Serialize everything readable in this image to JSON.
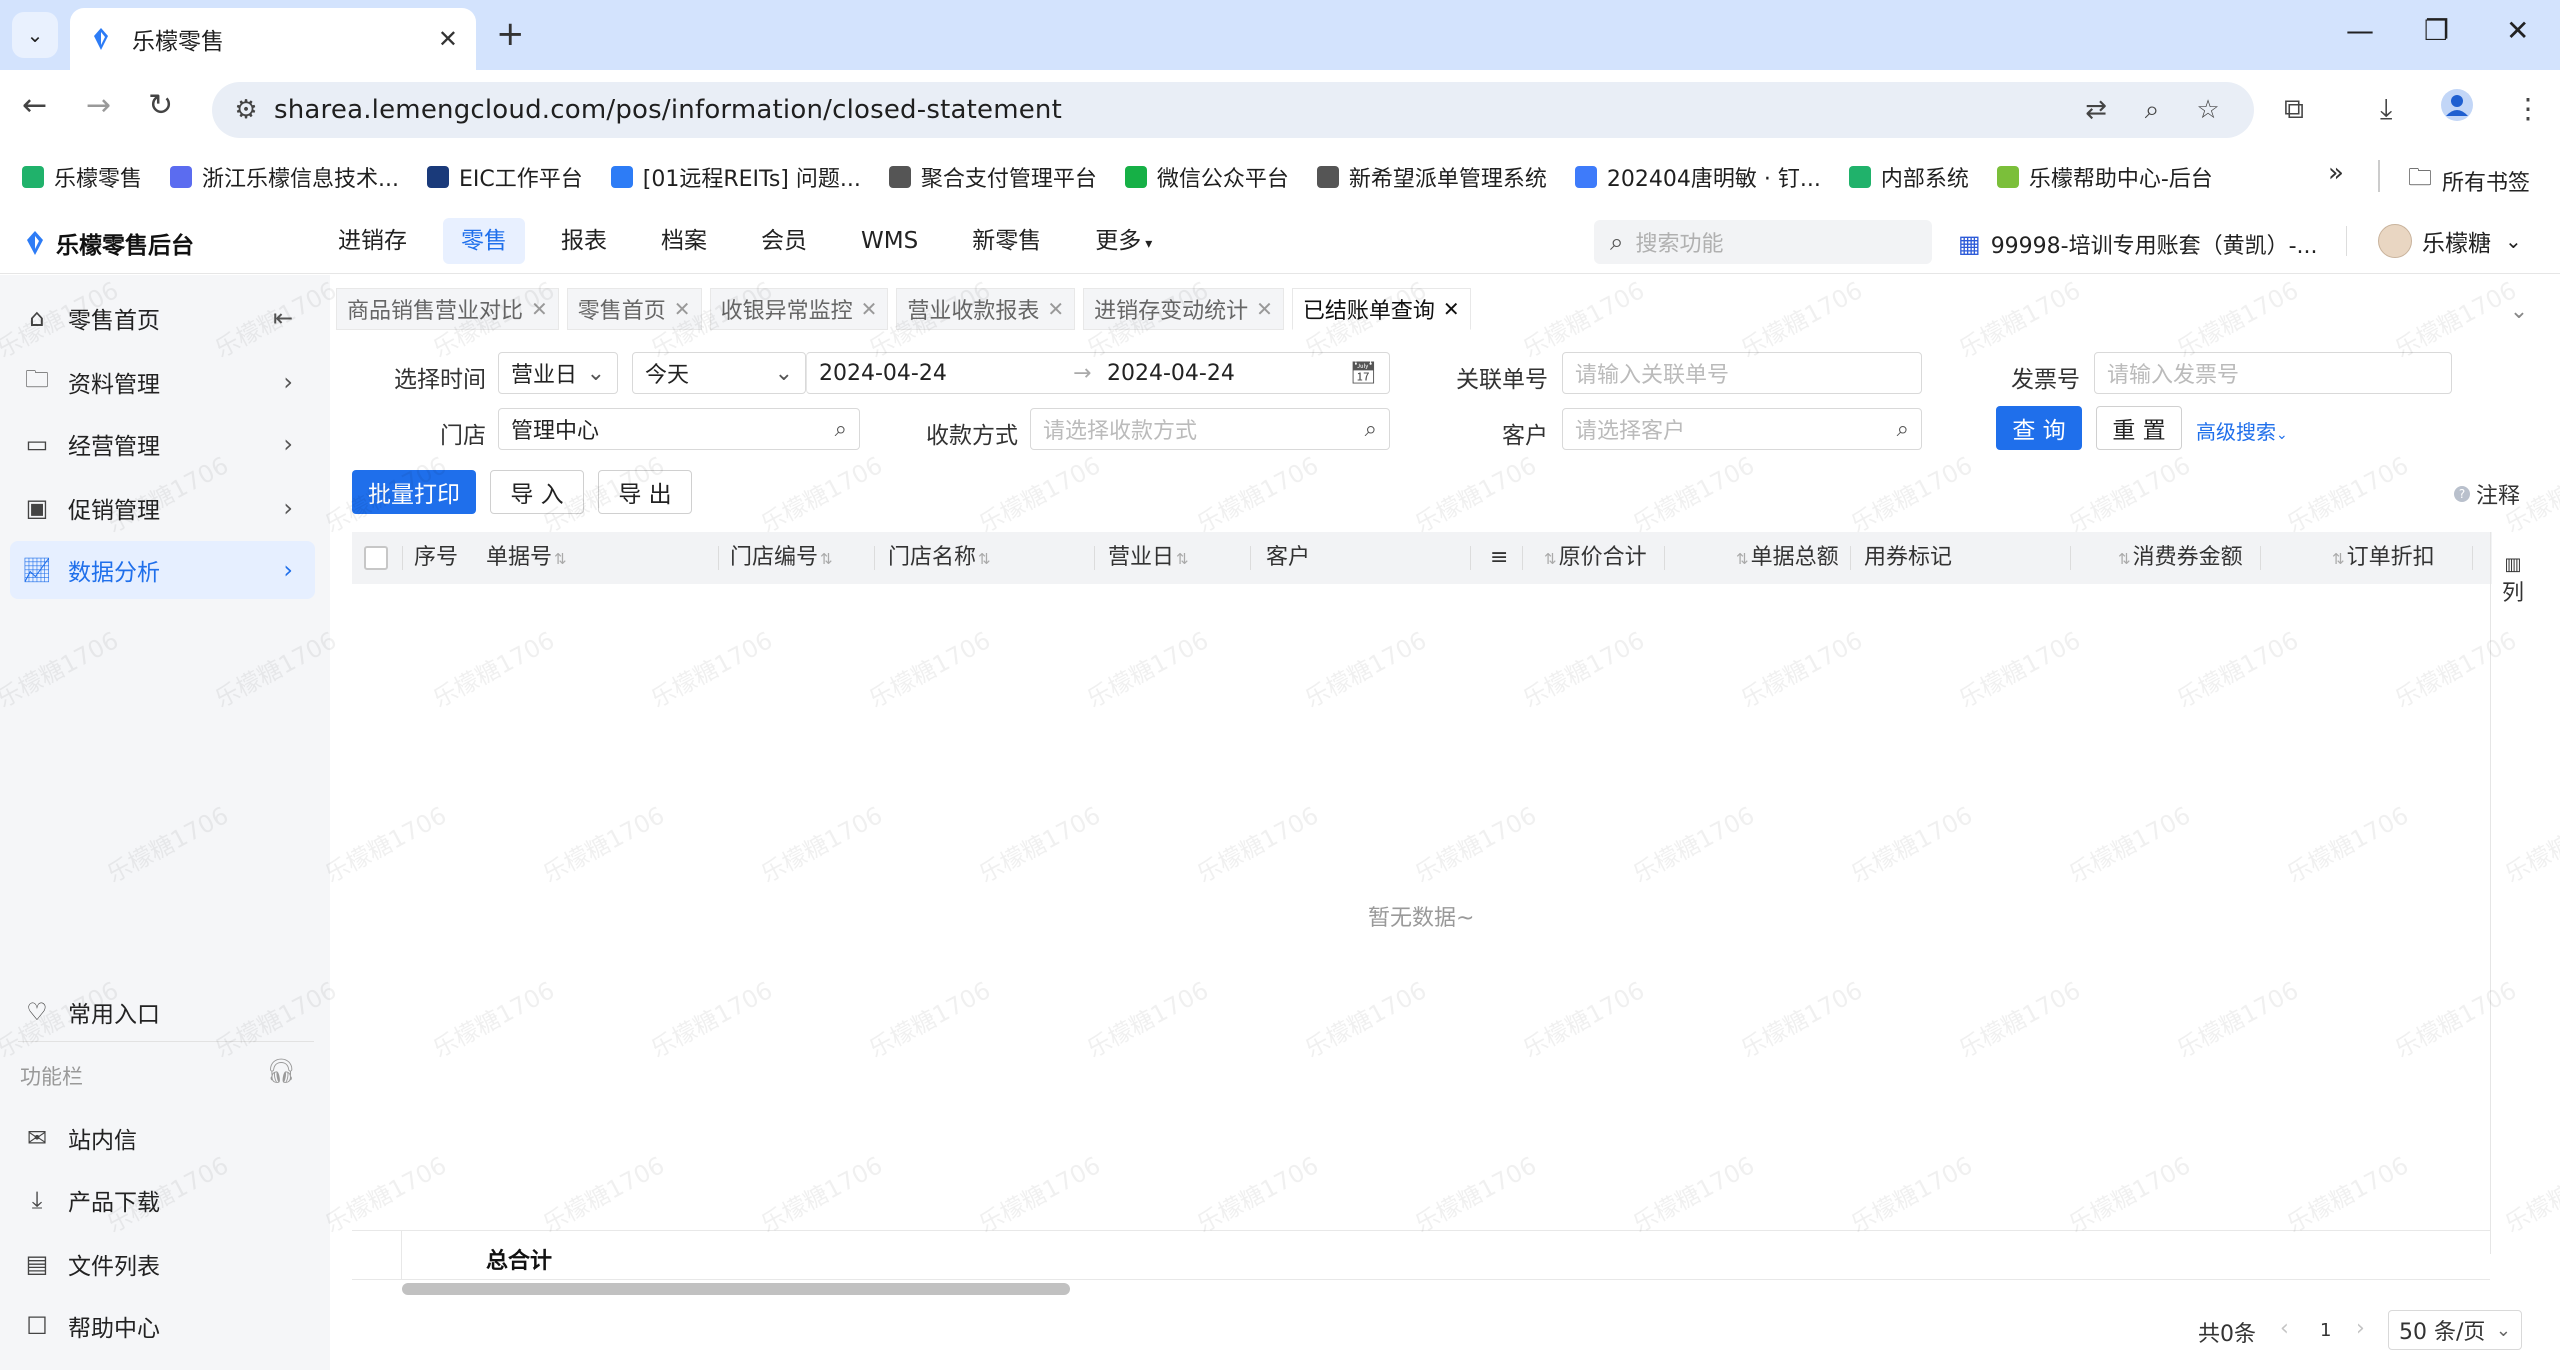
{
  "browser": {
    "tab_title": "乐檬零售",
    "url": "sharea.lemengcloud.com/pos/information/closed-statement",
    "bookmarks": [
      {
        "label": "乐檬零售",
        "color": "#20b26b"
      },
      {
        "label": "浙江乐檬信息技术...",
        "color": "#5b6cf0"
      },
      {
        "label": "EIC工作平台",
        "color": "#1a3a7a"
      },
      {
        "label": "[01远程REITs] 问题...",
        "color": "#2d7cf6"
      },
      {
        "label": "聚合支付管理平台",
        "color": "#555555"
      },
      {
        "label": "微信公众平台",
        "color": "#16b046"
      },
      {
        "label": "新希望派单管理系统",
        "color": "#555555"
      },
      {
        "label": "202404唐明敏 · 钉...",
        "color": "#3e7bfa"
      },
      {
        "label": "内部系统",
        "color": "#20b26b"
      },
      {
        "label": "乐檬帮助中心-后台",
        "color": "#7bbf3a"
      }
    ],
    "all_bookmarks": "所有书签"
  },
  "app": {
    "logo": "乐檬零售后台",
    "nav": [
      "进销存",
      "零售",
      "报表",
      "档案",
      "会员",
      "WMS",
      "新零售"
    ],
    "nav_more": "更多",
    "search_placeholder": "搜索功能",
    "account": "99998-培训专用账套（黄凯）-...",
    "user": "乐檬糖"
  },
  "sidebar": {
    "items": [
      {
        "label": "零售首页"
      },
      {
        "label": "资料管理"
      },
      {
        "label": "经营管理"
      },
      {
        "label": "促销管理"
      },
      {
        "label": "数据分析"
      }
    ],
    "common_entry": "常用入口",
    "section_label": "功能栏",
    "bottom": [
      {
        "label": "站内信"
      },
      {
        "label": "产品下载"
      },
      {
        "label": "文件列表"
      },
      {
        "label": "帮助中心"
      }
    ]
  },
  "page_tabs": [
    "商品销售营业对比",
    "零售首页",
    "收银异常监控",
    "营业收款报表",
    "进销存变动统计",
    "已结账单查询"
  ],
  "filters": {
    "time_label": "选择时间",
    "time_type": "营业日",
    "time_range": "今天",
    "date_from": "2024-04-24",
    "date_to": "2024-04-24",
    "related_label": "关联单号",
    "related_placeholder": "请输入关联单号",
    "invoice_label": "发票号",
    "invoice_placeholder": "请输入发票号",
    "store_label": "门店",
    "store_value": "管理中心",
    "payment_label": "收款方式",
    "payment_placeholder": "请选择收款方式",
    "customer_label": "客户",
    "customer_placeholder": "请选择客户",
    "query": "查 询",
    "reset": "重 置",
    "advanced": "高级搜索"
  },
  "actions": {
    "batch_print": "批量打印",
    "import": "导 入",
    "export": "导 出",
    "note": "注释"
  },
  "table": {
    "columns": [
      "序号",
      "单据号",
      "门店编号",
      "门店名称",
      "营业日",
      "客户",
      "原价合计",
      "单据总额",
      "用券标记",
      "消费券金额",
      "订单折扣"
    ],
    "column_settings": "列",
    "empty_text": "暂无数据~",
    "total_label": "总合计"
  },
  "pagination": {
    "total": "共0条",
    "page": "1",
    "page_size": "50 条/页"
  },
  "watermark": "乐檬糖1706"
}
